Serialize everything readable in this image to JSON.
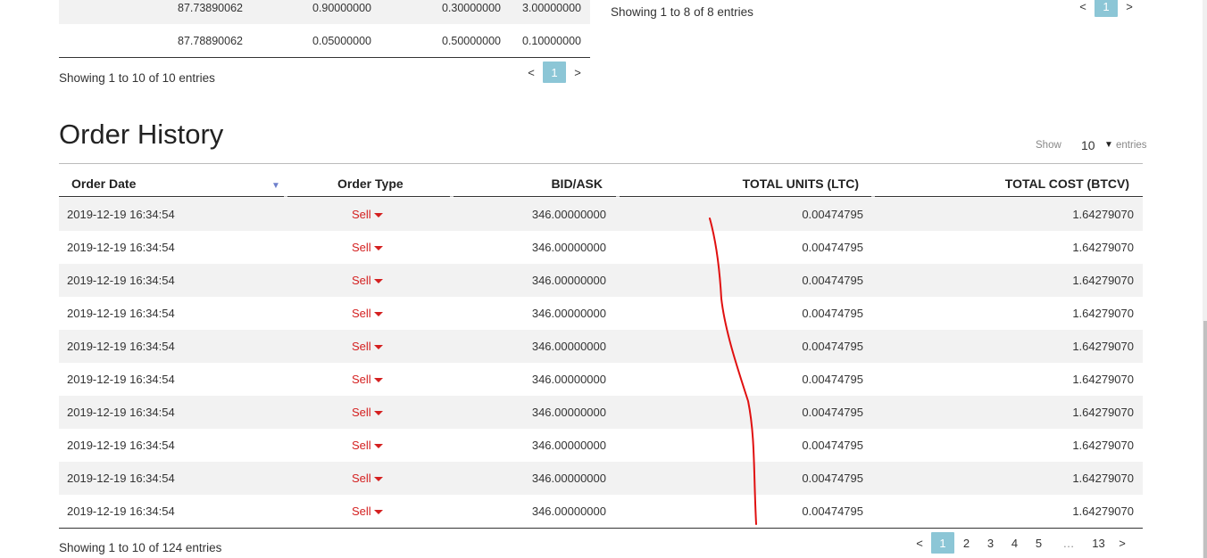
{
  "top_left_table": {
    "rows": [
      [
        "87.73890062",
        "0.90000000",
        "0.30000000",
        "3.00000000"
      ],
      [
        "87.78890062",
        "0.05000000",
        "0.50000000",
        "0.10000000"
      ]
    ],
    "info": "Showing 1 to 10 of 10 entries",
    "pager": {
      "prev": "<",
      "current": "1",
      "next": ">"
    }
  },
  "top_right_table": {
    "info": "Showing 1 to 8 of 8 entries",
    "pager": {
      "prev": "<",
      "current": "1",
      "next": ">"
    }
  },
  "order_history": {
    "title": "Order History",
    "length_label_before": "Show",
    "length_value": "10",
    "length_label_after": "entries",
    "columns": [
      "Order Date",
      "Order Type",
      "BID/ASK",
      "TOTAL UNITS (LTC)",
      "TOTAL COST (BTCV)"
    ],
    "sort_icon": "sort-desc-icon",
    "rows": [
      {
        "date": "2019-12-19 16:34:54",
        "type": "Sell",
        "bid": "346.00000000",
        "units": "0.00474795",
        "cost": "1.64279070"
      },
      {
        "date": "2019-12-19 16:34:54",
        "type": "Sell",
        "bid": "346.00000000",
        "units": "0.00474795",
        "cost": "1.64279070"
      },
      {
        "date": "2019-12-19 16:34:54",
        "type": "Sell",
        "bid": "346.00000000",
        "units": "0.00474795",
        "cost": "1.64279070"
      },
      {
        "date": "2019-12-19 16:34:54",
        "type": "Sell",
        "bid": "346.00000000",
        "units": "0.00474795",
        "cost": "1.64279070"
      },
      {
        "date": "2019-12-19 16:34:54",
        "type": "Sell",
        "bid": "346.00000000",
        "units": "0.00474795",
        "cost": "1.64279070"
      },
      {
        "date": "2019-12-19 16:34:54",
        "type": "Sell",
        "bid": "346.00000000",
        "units": "0.00474795",
        "cost": "1.64279070"
      },
      {
        "date": "2019-12-19 16:34:54",
        "type": "Sell",
        "bid": "346.00000000",
        "units": "0.00474795",
        "cost": "1.64279070"
      },
      {
        "date": "2019-12-19 16:34:54",
        "type": "Sell",
        "bid": "346.00000000",
        "units": "0.00474795",
        "cost": "1.64279070"
      },
      {
        "date": "2019-12-19 16:34:54",
        "type": "Sell",
        "bid": "346.00000000",
        "units": "0.00474795",
        "cost": "1.64279070"
      },
      {
        "date": "2019-12-19 16:34:54",
        "type": "Sell",
        "bid": "346.00000000",
        "units": "0.00474795",
        "cost": "1.64279070"
      }
    ],
    "info": "Showing 1 to 10 of 124 entries",
    "pager": {
      "prev": "<",
      "pages": [
        "1",
        "2",
        "3",
        "4",
        "5",
        "…",
        "13"
      ],
      "next": ">"
    }
  },
  "colors": {
    "sell": "#d42020",
    "active_page": "#8cc6d6",
    "annotation": "#e01010"
  }
}
